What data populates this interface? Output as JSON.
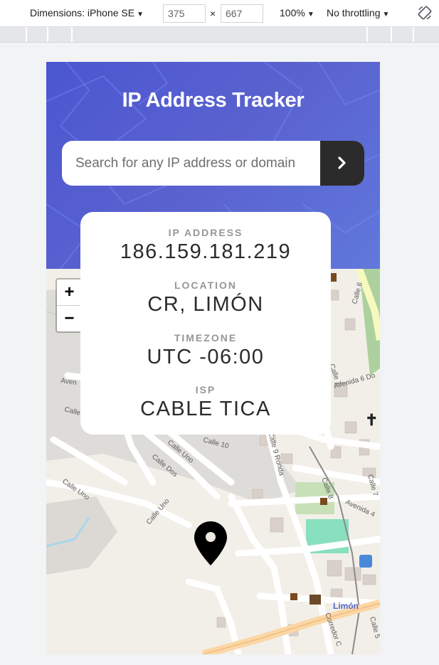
{
  "devtools": {
    "device": "Dimensions: iPhone SE",
    "width": "375",
    "times": "×",
    "height": "667",
    "zoom": "100%",
    "throttling": "No throttling",
    "caret": "▼"
  },
  "app": {
    "title": "IP Address Tracker",
    "search": {
      "placeholder": "Search for any IP address or domain",
      "value": ""
    },
    "go_icon": "chevron-right-icon",
    "info": [
      {
        "label": "IP ADDRESS",
        "value": "186.159.181.219"
      },
      {
        "label": "LOCATION",
        "value": "CR, LIMÓN"
      },
      {
        "label": "TIMEZONE",
        "value": "UTC -06:00"
      },
      {
        "label": "ISP",
        "value": "CABLE TICA"
      }
    ]
  },
  "map": {
    "zoom_in": "+",
    "zoom_out": "−",
    "labels": {
      "calle6": "Calle 6",
      "calle7": "Calle 7",
      "avenida6": "Avenida 6 Do",
      "avenida": "Aven",
      "calle10": "Calle 10",
      "calle9ronda": "Calle 9 Ronda",
      "calleuno1": "Calle Uno",
      "calledos": "Calle Dos",
      "calleuno2": "Calle Uno",
      "calleuno3": "Calle Uno",
      "calle8": "Calle 8",
      "avenida4": "Avenida 4",
      "calle_r": "Calle 7",
      "calle_br": "Calle 5",
      "corredor": "Corredor C",
      "limon": "Limón",
      "calle_left": "Calle"
    },
    "colors": {
      "road": "#ffffff",
      "highway": "#fcd6a4",
      "green": "#add19e",
      "pitch": "#88e0be",
      "building": "#d9d0c9",
      "rail": "#777777"
    }
  }
}
